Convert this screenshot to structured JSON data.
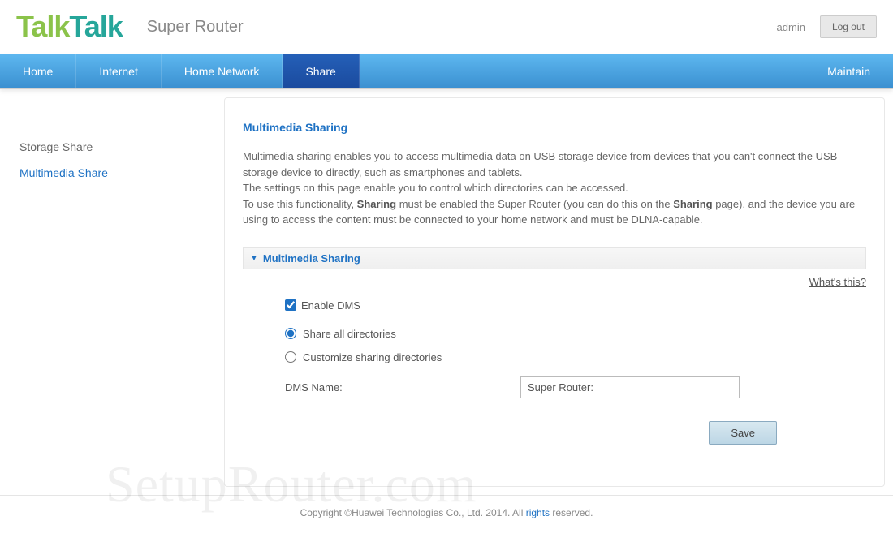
{
  "header": {
    "logo_part1": "Talk",
    "logo_part2": "Talk",
    "product": "Super Router",
    "username": "admin",
    "logout": "Log out"
  },
  "nav": {
    "home": "Home",
    "internet": "Internet",
    "home_network": "Home Network",
    "share": "Share",
    "maintain": "Maintain"
  },
  "sidebar": {
    "storage_share": "Storage Share",
    "multimedia_share": "Multimedia Share"
  },
  "main": {
    "title": "Multimedia Sharing",
    "desc_line1": "Multimedia sharing enables you to access multimedia data on USB storage device from devices that you can't connect the USB storage device to directly, such as smartphones and tablets.",
    "desc_line2": "The settings on this page enable you to control which directories can be accessed.",
    "desc_line3a": "To use this functionality, ",
    "desc_line3_bold1": "Sharing",
    "desc_line3b": " must be enabled the Super Router (you can do this on the ",
    "desc_line3_bold2": "Sharing",
    "desc_line3c": " page), and the device you are using to access the content must be connected to your home network and must be DLNA-capable.",
    "collapsible_title": "Multimedia Sharing",
    "whats_this": "What's this?",
    "enable_dms": "Enable DMS",
    "radio_all": "Share all directories",
    "radio_custom": "Customize sharing directories",
    "dms_name_label": "DMS Name:",
    "dms_name_value": "Super Router:",
    "save": "Save"
  },
  "footer": {
    "text_a": "Copyright ©Huawei Technologies Co., Ltd. 2014. All ",
    "link": "rights",
    "text_b": " reserved."
  },
  "watermark": "SetupRouter.com"
}
